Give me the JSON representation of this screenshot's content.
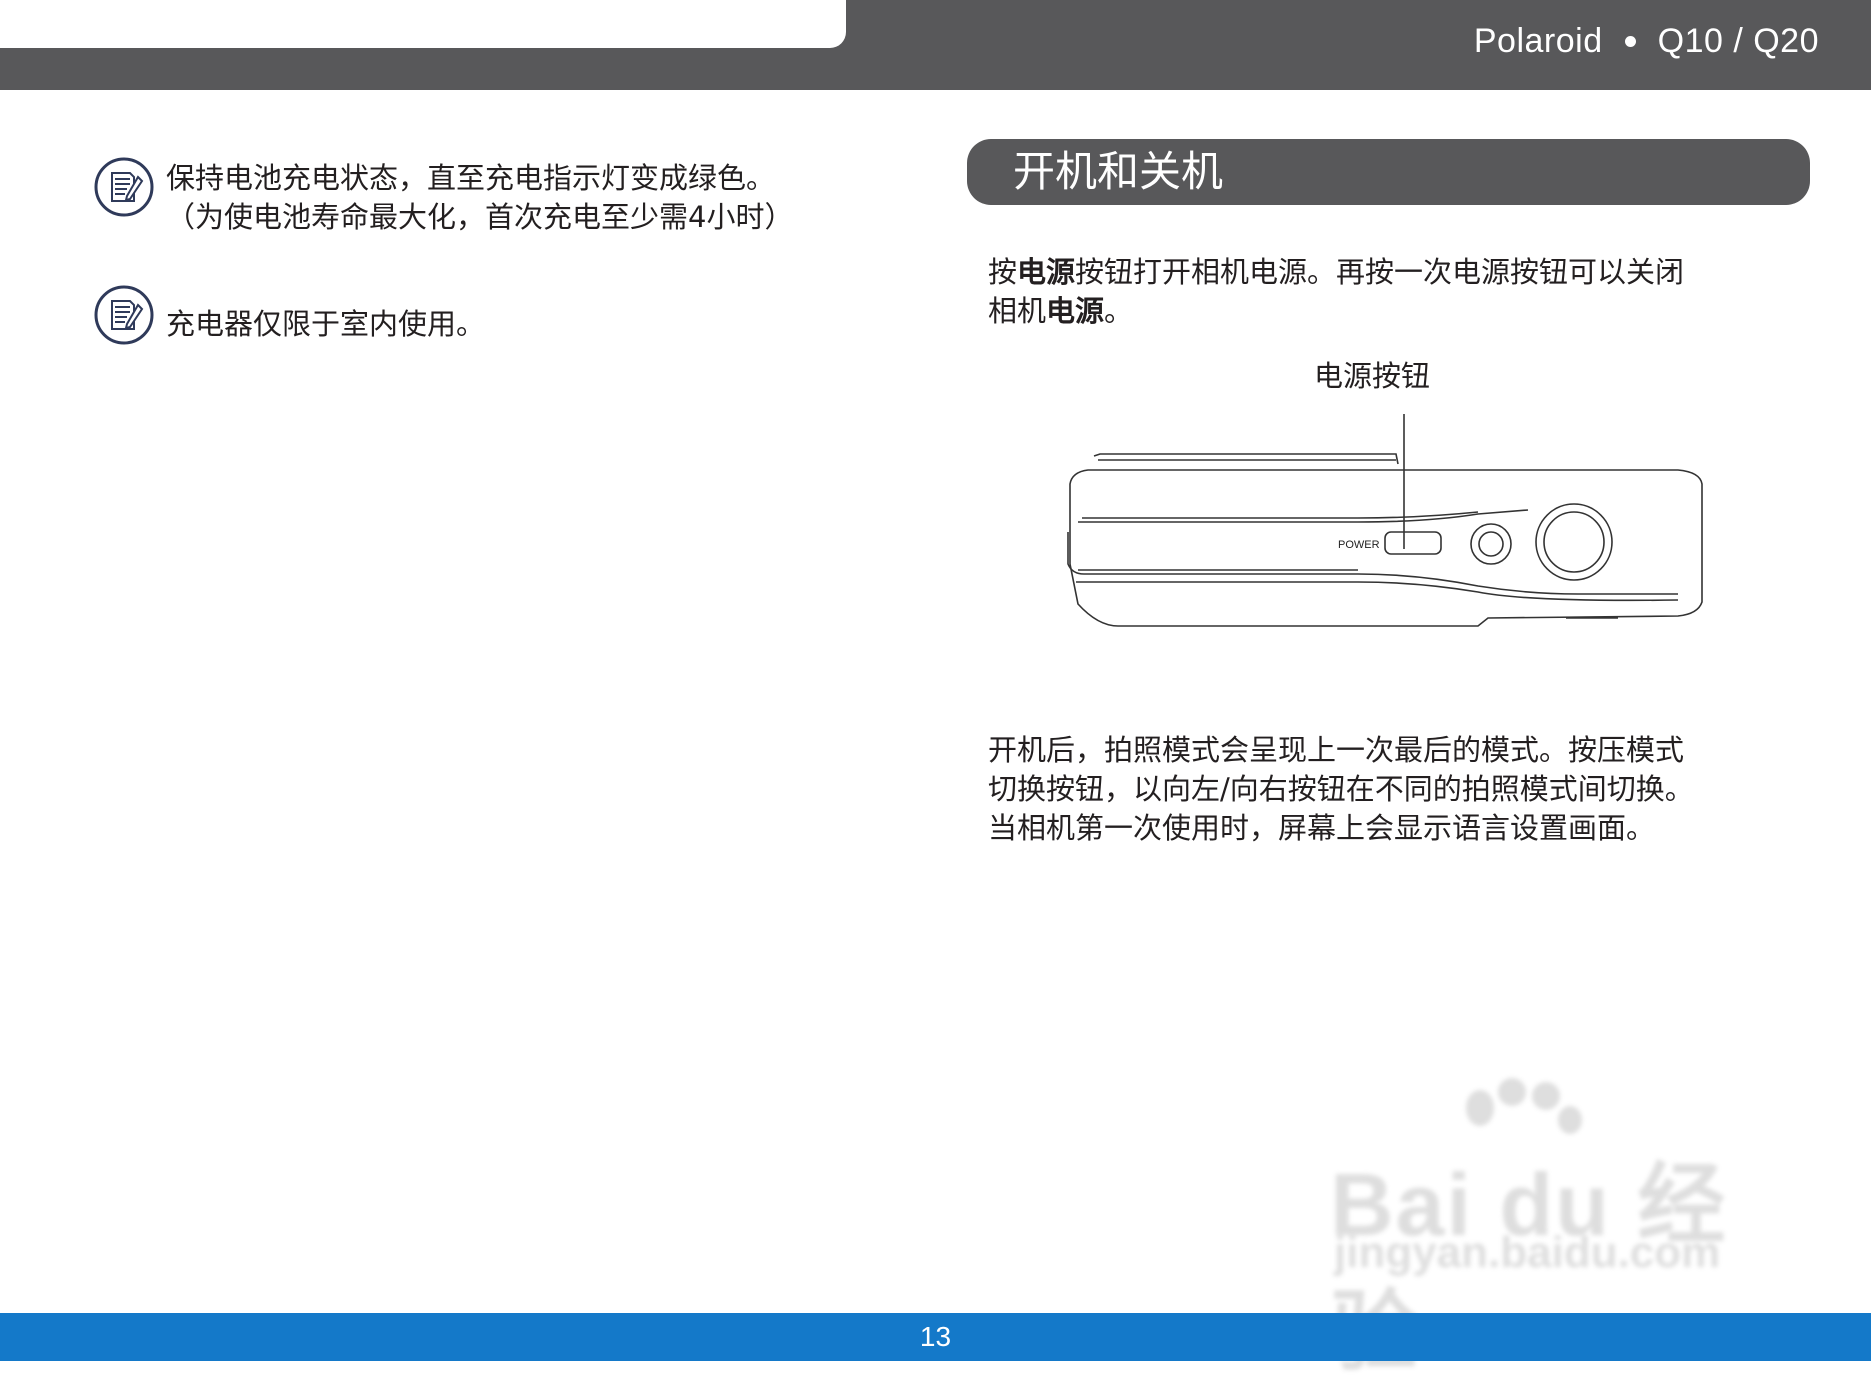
{
  "header": {
    "brand": "Polaroid",
    "model": "Q10 / Q20"
  },
  "notes": [
    {
      "icon": "note-pencil-icon",
      "lines": [
        "保持电池充电状态，直至充电指示灯变成绿色。",
        "（为使电池寿命最大化，首次充电至少需4小时）"
      ]
    },
    {
      "icon": "note-pencil-icon",
      "lines": [
        "充电器仅限于室内使用。"
      ]
    }
  ],
  "section": {
    "title": "开机和关机",
    "intro": {
      "line1_a": "按",
      "line1_b": "电源",
      "line1_c": "按钮打开相机电源。再按一次电源按钮可以关闭",
      "line2_a": "相机",
      "line2_b": "电源",
      "line2_c": "。"
    },
    "callout_label": "电源按钮",
    "camera_power_label": "POWER",
    "after_lines": [
      "开机后，拍照模式会呈现上一次最后的模式。按压模式",
      "切换按钮，以向左/向右按钮在不同的拍照模式间切换。",
      "当相机第一次使用时，屏幕上会显示语言设置画面。"
    ]
  },
  "watermark": {
    "main": "Bai du 经验",
    "sub": "jingyan.baidu.com"
  },
  "footer": {
    "page_number": "13"
  },
  "colors": {
    "header_bar": "#58585a",
    "footer_bar": "#1479c9",
    "text": "#231f20",
    "icon_stroke": "#2f3a5a"
  }
}
